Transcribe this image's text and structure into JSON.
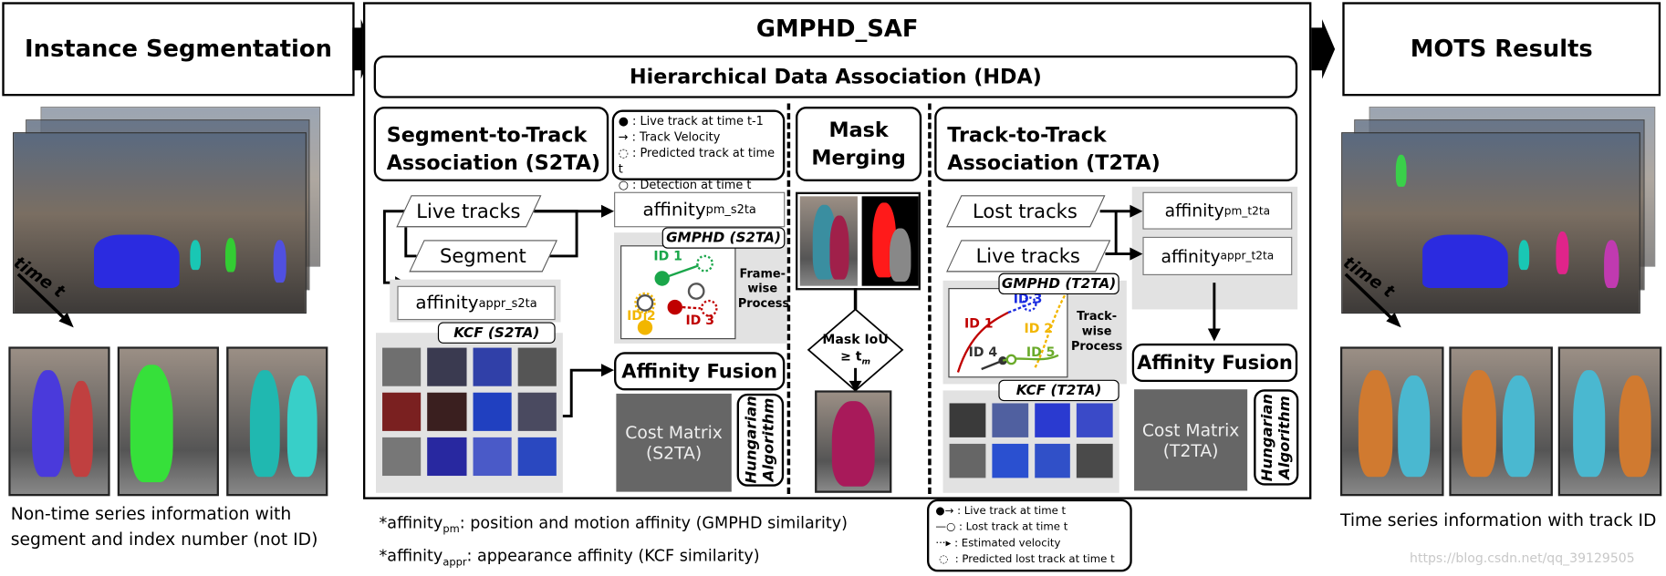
{
  "left": {
    "title": "Instance Segmentation",
    "time_label": "time t",
    "caption": [
      "Non-time series information with",
      "segment and index number (not ID)"
    ]
  },
  "main": {
    "title": "GMPHD_SAF",
    "hda": "Hierarchical Data Association (HDA)",
    "s2ta": {
      "title": [
        "Segment-to-Track",
        "Association (S2TA)"
      ],
      "legend": [
        "Live track at time t-1",
        "Track Velocity",
        "Predicted track at time t",
        "Detection at time t"
      ],
      "live_tracks": "Live tracks",
      "segment": "Segment",
      "affinity_pm": {
        "base": "affinity",
        "sub": "pm_s2ta"
      },
      "affinity_appr": {
        "base": "affinity",
        "sub": "appr_s2ta"
      },
      "gmphd_label": "GMPHD (S2TA)",
      "kcf_label": "KCF (S2TA)",
      "process_label": [
        "Frame-",
        "wise",
        "Process"
      ],
      "ids": [
        "ID 1",
        "ID 2",
        "ID 3"
      ],
      "affinity_fusion": "Affinity Fusion",
      "cost_matrix": [
        "Cost Matrix",
        "(S2TA)"
      ],
      "hungarian": [
        "Hungarian",
        "Algorithm"
      ]
    },
    "mask": {
      "title": [
        "Mask",
        "Merging"
      ],
      "decision": [
        "Mask IoU",
        "≥ t"
      ],
      "decision_sub": "m"
    },
    "t2ta": {
      "title": [
        "Track-to-Track",
        "Association (T2TA)"
      ],
      "lost_tracks": "Lost tracks",
      "live_tracks": "Live tracks",
      "affinity_pm": {
        "base": "affinity",
        "sub": "pm_t2ta"
      },
      "affinity_appr": {
        "base": "affinity",
        "sub": "appr_t2ta"
      },
      "gmphd_label": "GMPHD (T2TA)",
      "kcf_label": "KCF (T2TA)",
      "process_label": [
        "Track-",
        "wise",
        "Process"
      ],
      "ids": [
        "ID 1",
        "ID 2",
        "ID 3",
        "ID 4",
        "ID 5"
      ],
      "affinity_fusion": "Affinity Fusion",
      "cost_matrix": [
        "Cost Matrix",
        "(T2TA)"
      ],
      "hungarian": [
        "Hungarian",
        "Algorithm"
      ],
      "legend": [
        "Live track at time t",
        "Lost track at time t",
        "Estimated velocity",
        "Predicted lost track at time t"
      ]
    }
  },
  "footnotes": [
    {
      "prefix": "*affinity",
      "sub": "pm",
      "text": ": position and motion affinity (GMPHD similarity)"
    },
    {
      "prefix": "*affinity",
      "sub": "appr",
      "text": ": appearance affinity (KCF similarity)"
    }
  ],
  "right": {
    "title": "MOTS Results",
    "time_label": "time t",
    "caption": "Time series information with track ID"
  },
  "watermark": "https://blog.csdn.net/qq_39129505",
  "colors": {
    "id1": "#1aa64a",
    "id2": "#f2b600",
    "id3": "#c00000",
    "id3_t2ta": "#1a2be0",
    "id5": "#6aaa2a",
    "cost_matrix": "#666666"
  }
}
